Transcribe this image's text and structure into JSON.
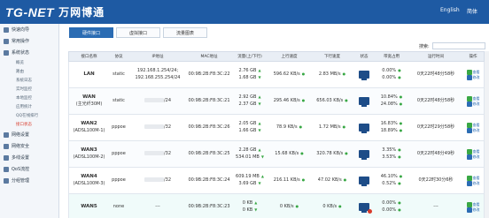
{
  "header": {
    "logo": "TG-NET",
    "brand_cn": "万网博通",
    "lang_en": "English",
    "lang_cn": "简体"
  },
  "sidebar": {
    "items": [
      {
        "label": "快速向导"
      },
      {
        "label": "常用操作"
      },
      {
        "label": "系统状态"
      }
    ],
    "subitems": [
      {
        "label": "概览"
      },
      {
        "label": "路由"
      },
      {
        "label": "系统日志"
      },
      {
        "label": "实时监控"
      },
      {
        "label": "本地监控"
      },
      {
        "label": "应用统计"
      },
      {
        "label": "QQ在线排行"
      },
      {
        "label": "接口状态"
      }
    ],
    "items_bottom": [
      {
        "label": "网络设置"
      },
      {
        "label": "网络安全"
      },
      {
        "label": "多线设置"
      },
      {
        "label": "QoS流控"
      },
      {
        "label": "分组管理"
      }
    ]
  },
  "tabs": [
    {
      "label": "硬件接口"
    },
    {
      "label": "虚拟接口"
    },
    {
      "label": "流量图表"
    }
  ],
  "search": {
    "label": "搜索:"
  },
  "table": {
    "columns": [
      "接口名称",
      "协议",
      "IP地址",
      "MAC地址",
      "流量(上/下行)",
      "上行速度",
      "下行速度",
      "状态",
      "带宽占用",
      "运行时间",
      "操作"
    ],
    "rows": [
      {
        "name": "LAN",
        "sub": "",
        "proto": "static",
        "ip1": "192.168.1.254/24;",
        "ip2": "192.168.255.254/24",
        "mac": "00:9B:2B:F8:3C:22",
        "traffic_up": "2.76 GB",
        "traffic_down": "1.68 GB",
        "up_speed": "596.62 KB/s",
        "down_speed": "2.83 MB/s",
        "bw_up": "0.00%",
        "bw_down": "0.00%",
        "uptime": "0天22时48分58秒"
      },
      {
        "name": "WAN",
        "sub": "(主光纤30M)",
        "proto": "static",
        "ip1": "/24",
        "ip2": "",
        "mac": "00:9B:2B:F8:3C:21",
        "traffic_up": "2.92 GB",
        "traffic_down": "2.37 GB",
        "up_speed": "295.46 KB/s",
        "down_speed": "656.03 KB/s",
        "bw_up": "10.84%",
        "bw_down": "24.08%",
        "uptime": "0天22时48分58秒"
      },
      {
        "name": "WAN2",
        "sub": "(ADSL100M-1)",
        "proto": "pppoe",
        "ip1": "/32",
        "ip2": "",
        "mac": "00:9B:2B:F8:3C:26",
        "traffic_up": "2.05 GB",
        "traffic_down": "1.66 GB",
        "up_speed": "78.9 KB/s",
        "down_speed": "1.72 MB/s",
        "bw_up": "16.83%",
        "bw_down": "18.89%",
        "uptime": "0天22时29分58秒"
      },
      {
        "name": "WAN3",
        "sub": "(ADSL100M-2)",
        "proto": "pppoe",
        "ip1": "/32",
        "ip2": "",
        "mac": "00:9B:2B:F8:3C:25",
        "traffic_up": "2.28 GB",
        "traffic_down": "534.01 MB",
        "up_speed": "15.68 KB/s",
        "down_speed": "320.78 KB/s",
        "bw_up": "3.35%",
        "bw_down": "3.53%",
        "uptime": "0天22时48分49秒"
      },
      {
        "name": "WAN4",
        "sub": "(ADSL100M-3)",
        "proto": "pppoe",
        "ip1": "/32",
        "ip2": "",
        "mac": "00:9B:2B:F8:3C:24",
        "traffic_up": "609.19 MB",
        "traffic_down": "3.69 GB",
        "up_speed": "216.11 KB/s",
        "down_speed": "47.02 KB/s",
        "bw_up": "46.10%",
        "bw_down": "0.52%",
        "uptime": "0天22时30分6秒"
      },
      {
        "name": "WAN5",
        "sub": "",
        "proto": "none",
        "ip1": "---",
        "ip2": "",
        "mac": "00:9B:2B:F8:3C:23",
        "traffic_up": "0 KB",
        "traffic_down": "0 KB",
        "up_speed": "0 KB/s",
        "down_speed": "0 KB/s",
        "bw_up": "0.00%",
        "bw_down": "0.00%",
        "uptime": "---"
      }
    ],
    "op_labels": [
      "查看",
      "修改"
    ]
  }
}
